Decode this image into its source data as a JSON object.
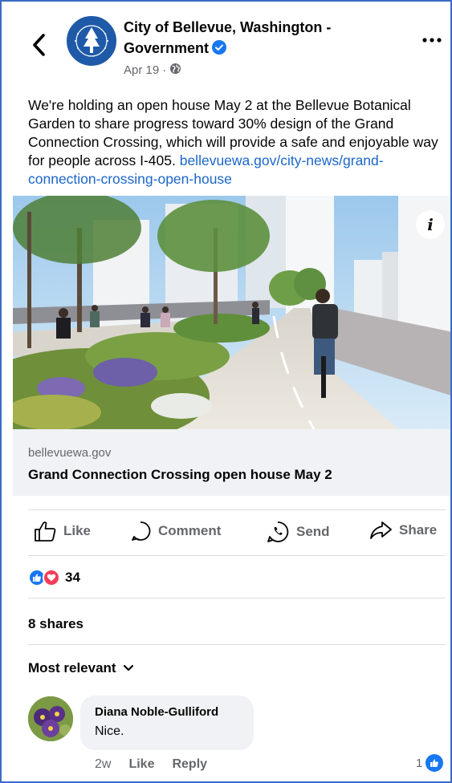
{
  "header": {
    "page_name": "City of Bellevue, Washington - Government",
    "date": "Apr 19",
    "separator": "·"
  },
  "post": {
    "text": "We're holding an open house May 2 at the Bellevue Botanical Garden to share progress toward 30% design of the Grand Connection Crossing, which will provide a safe and enjoyable way for people across I-405. ",
    "link_text": "bellevuewa.gov/city-news/grand-connection-crossing-open-house"
  },
  "link_card": {
    "domain": "bellevuewa.gov",
    "title": "Grand Connection Crossing open house May 2"
  },
  "actions": {
    "like": "Like",
    "comment": "Comment",
    "send": "Send",
    "share": "Share"
  },
  "engagement": {
    "reaction_count": "34",
    "shares": "8 shares",
    "sort_label": "Most relevant"
  },
  "comment": {
    "author": "Diana Noble-Gulliford",
    "text": "Nice.",
    "age": "2w",
    "like_label": "Like",
    "reply_label": "Reply",
    "like_count": "1"
  },
  "colors": {
    "accent": "#1877f2",
    "link": "#1b66c9",
    "muted": "#65676b",
    "love": "#f33e58"
  }
}
